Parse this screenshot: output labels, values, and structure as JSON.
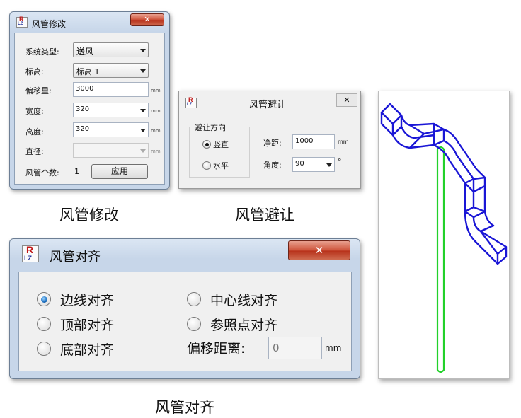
{
  "dialog_modify": {
    "title": "风管修改",
    "close_label": "✕",
    "fields": [
      {
        "label": "系统类型:",
        "value": "送风",
        "kind": "combo"
      },
      {
        "label": "标高:",
        "value": "标高 1",
        "kind": "combo"
      },
      {
        "label": "偏移里:",
        "value": "3000",
        "kind": "text",
        "unit": "mm"
      },
      {
        "label": "宽度:",
        "value": "320",
        "kind": "text-drop",
        "unit": "mm"
      },
      {
        "label": "高度:",
        "value": "320",
        "kind": "text-drop",
        "unit": "mm"
      },
      {
        "label": "直径:",
        "value": "",
        "kind": "disabled-drop",
        "unit": "mm"
      }
    ],
    "count_label": "风管个数:",
    "count_value": "1",
    "apply_label": "应用"
  },
  "dialog_avoid": {
    "title": "风管避让",
    "close_label": "✕",
    "group_label": "避让方向",
    "options": [
      {
        "label": "竖直",
        "selected": true
      },
      {
        "label": "水平",
        "selected": false
      }
    ],
    "clearance_label": "净距:",
    "clearance_value": "1000",
    "clearance_unit": "mm",
    "angle_label": "角度:",
    "angle_value": "90",
    "angle_unit": "°"
  },
  "dialog_align": {
    "title": "风管对齐",
    "close_label": "✕",
    "options": [
      {
        "label": "边线对齐",
        "selected": true
      },
      {
        "label": "中心线对齐",
        "selected": false
      },
      {
        "label": "顶部对齐",
        "selected": false
      },
      {
        "label": "参照点对齐",
        "selected": false
      },
      {
        "label": "底部对齐",
        "selected": false
      }
    ],
    "offset_label": "偏移距离:",
    "offset_value": "0",
    "offset_unit": "mm"
  },
  "logo": {
    "top": "R",
    "bottom": "LZ"
  },
  "captions": {
    "modify": "风管修改",
    "avoid": "风管避让",
    "align": "风管对齐"
  },
  "colors": {
    "duct": "#1a16d6",
    "pipe": "#22d12a",
    "close_button": "#c9442a"
  }
}
